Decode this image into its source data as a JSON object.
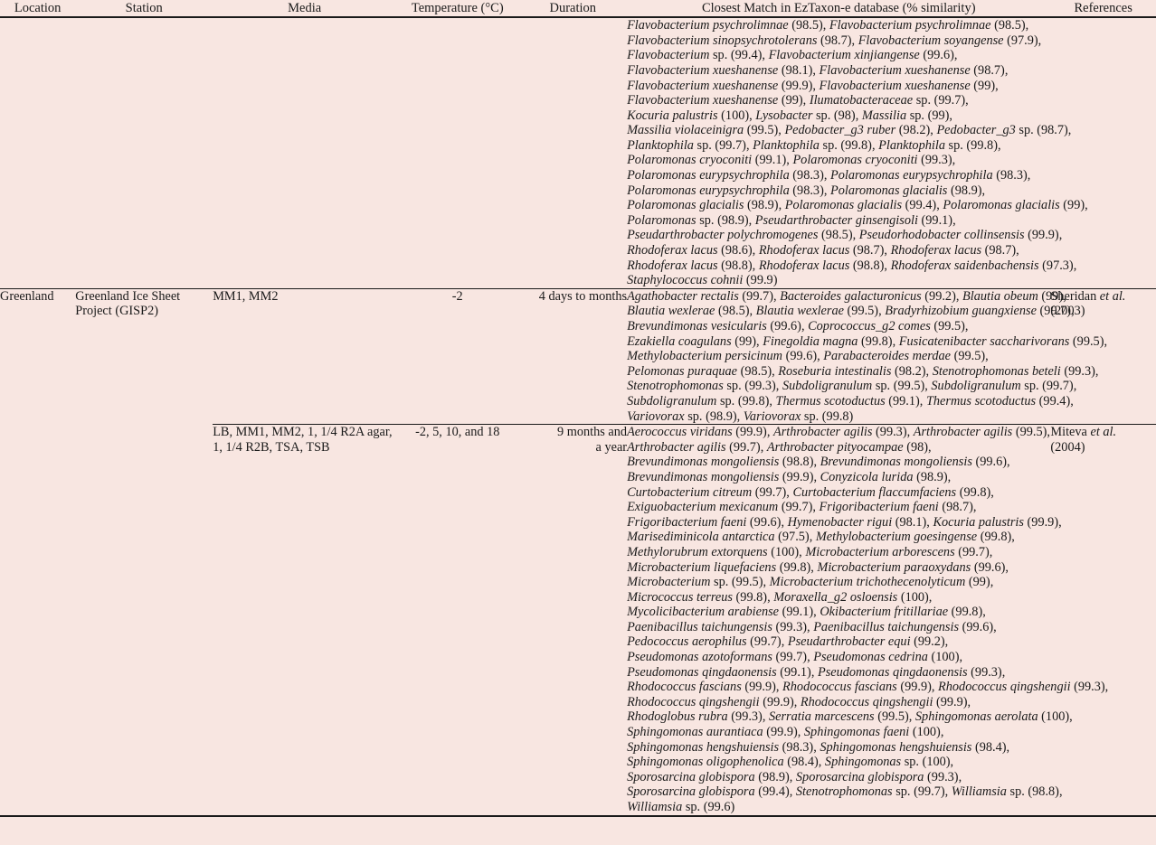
{
  "table": {
    "headers": [
      "Location",
      "Station",
      "Media",
      "Temperature (°C)",
      "Duration",
      "Closest Match in EzTaxon-e database (% similarity)",
      "References"
    ],
    "colors": {
      "background": "#f8e6e1",
      "rule": "#1a1a1a",
      "text": "#1a1a1a"
    },
    "rows": [
      {
        "location": "",
        "station": "",
        "media": "",
        "temperature": "",
        "duration": "",
        "reference_lines": [],
        "matches": [
          "Flavobacterium psychrolimnae (98.5), Flavobacterium psychrolimnae (98.5),",
          "Flavobacterium sinopsychrotolerans (98.7), Flavobacterium soyangense (97.9),",
          "Flavobacterium sp. (99.4), Flavobacterium xinjiangense (99.6),",
          "Flavobacterium xueshanense (98.1), Flavobacterium xueshanense (98.7),",
          "Flavobacterium xueshanense (99.9), Flavobacterium xueshanense (99),",
          "Flavobacterium xueshanense (99), Ilumatobacteraceae sp. (99.7),",
          "Kocuria palustris (100), Lysobacter sp. (98), Massilia sp. (99),",
          "Massilia violaceinigra (99.5), Pedobacter_g3 ruber (98.2), Pedobacter_g3 sp. (98.7),",
          "Planktophila sp. (99.7), Planktophila sp. (99.8), Planktophila sp. (99.8),",
          "Polaromonas cryoconiti (99.1), Polaromonas cryoconiti (99.3),",
          "Polaromonas eurypsychrophila (98.3), Polaromonas eurypsychrophila (98.3),",
          "Polaromonas eurypsychrophila (98.3), Polaromonas glacialis (98.9),",
          "Polaromonas glacialis (98.9), Polaromonas glacialis (99.4), Polaromonas glacialis (99),",
          "Polaromonas sp. (98.9), Pseudarthrobacter ginsengisoli (99.1),",
          "Pseudarthrobacter polychromogenes (98.5), Pseudorhodobacter collinsensis (99.9),",
          "Rhodoferax lacus (98.6), Rhodoferax lacus (98.7), Rhodoferax lacus (98.7),",
          "Rhodoferax lacus (98.8), Rhodoferax lacus (98.8), Rhodoferax saidenbachensis (97.3),",
          "Staphylococcus cohnii (99.9)"
        ]
      },
      {
        "location": "Greenland",
        "station": "Greenland Ice Sheet Project (GISP2)",
        "media": "MM1, MM2",
        "temperature": "-2",
        "duration": "4 days to months",
        "reference_lines": [
          "Sheridan et al.",
          "(2003)"
        ],
        "matches": [
          "Agathobacter rectalis (99.7), Bacteroides galacturonicus (99.2), Blautia obeum (99),",
          "Blautia wexlerae (98.5), Blautia wexlerae (99.5), Bradyrhizobium guangxiense (99.7),",
          "Brevundimonas vesicularis (99.6), Coprococcus_g2 comes (99.5),",
          "Ezakiella coagulans (99), Finegoldia magna (99.8), Fusicatenibacter saccharivorans (99.5),",
          "Methylobacterium persicinum (99.6), Parabacteroides merdae (99.5),",
          "Pelomonas puraquae (98.5), Roseburia intestinalis (98.2), Stenotrophomonas beteli (99.3),",
          "Stenotrophomonas sp. (99.3), Subdoligranulum sp. (99.5), Subdoligranulum sp. (99.7),",
          "Subdoligranulum sp. (99.8), Thermus scotoductus (99.1), Thermus scotoductus (99.4),",
          "Variovorax sp. (98.9), Variovorax sp. (99.8)"
        ]
      },
      {
        "location": "",
        "station": "",
        "media": "LB, MM1, MM2, 1, 1/4 R2A agar, 1, 1/4 R2B, TSA, TSB",
        "temperature": "-2, 5, 10, and 18",
        "duration_lines": [
          "9 months and",
          "a year"
        ],
        "duration": "9 months and a year",
        "reference_lines": [
          "Miteva et al.",
          "(2004)"
        ],
        "matches": [
          "Aerococcus viridans (99.9), Arthrobacter agilis (99.3), Arthrobacter agilis (99.5),",
          "Arthrobacter agilis (99.7), Arthrobacter pityocampae (98),",
          "Brevundimonas mongoliensis (98.8), Brevundimonas mongoliensis (99.6),",
          "Brevundimonas mongoliensis (99.9), Conyzicola lurida (98.9),",
          "Curtobacterium citreum (99.7), Curtobacterium flaccumfaciens (99.8),",
          "Exiguobacterium mexicanum (99.7), Frigoribacterium faeni (98.7),",
          "Frigoribacterium faeni (99.6), Hymenobacter rigui (98.1), Kocuria palustris (99.9),",
          "Marisediminicola antarctica (97.5), Methylobacterium goesingense (99.8),",
          "Methylorubrum extorquens (100), Microbacterium arborescens (99.7),",
          "Microbacterium liquefaciens (99.8), Microbacterium paraoxydans (99.6),",
          "Microbacterium sp. (99.5), Microbacterium trichothecenolyticum (99),",
          "Micrococcus terreus (99.8), Moraxella_g2 osloensis (100),",
          "Mycolicibacterium arabiense (99.1), Okibacterium fritillariae (99.8),",
          "Paenibacillus taichungensis (99.3), Paenibacillus taichungensis (99.6),",
          "Pedococcus aerophilus (99.7), Pseudarthrobacter equi (99.2),",
          "Pseudomonas azotoformans (99.7), Pseudomonas cedrina (100),",
          "Pseudomonas qingdaonensis (99.1), Pseudomonas qingdaonensis (99.3),",
          "Rhodococcus fascians (99.9), Rhodococcus fascians (99.9), Rhodococcus qingshengii (99.3),",
          "Rhodococcus qingshengii (99.9), Rhodococcus qingshengii (99.9),",
          "Rhodoglobus rubra (99.3), Serratia marcescens (99.5), Sphingomonas aerolata (100),",
          "Sphingomonas aurantiaca (99.9), Sphingomonas faeni (100),",
          "Sphingomonas hengshuiensis (98.3), Sphingomonas hengshuiensis (98.4),",
          "Sphingomonas oligophenolica (98.4), Sphingomonas sp. (100),",
          "Sporosarcina globispora (98.9), Sporosarcina globispora (99.3),",
          "Sporosarcina globispora (99.4), Stenotrophomonas sp. (99.7), Williamsia sp. (98.8),",
          "Williamsia sp. (99.6)"
        ]
      }
    ]
  }
}
